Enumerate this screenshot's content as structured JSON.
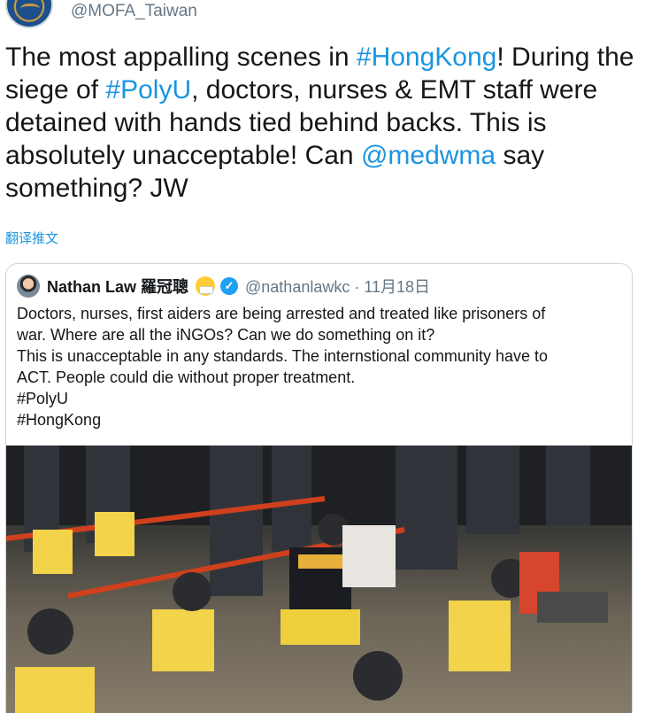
{
  "main_tweet": {
    "handle": "@MOFA_Taiwan",
    "text_1": "The most appalling scenes in ",
    "hashtag_1": "#HongKong",
    "text_2": "! During the siege of ",
    "hashtag_2": "#PolyU",
    "text_3": ", doctors, nurses & EMT staff were detained with hands tied behind backs. This is absolutely unacceptable! Can ",
    "mention": "@medwma",
    "text_4": " say something? JW",
    "translate_label": "翻译推文"
  },
  "quoted_tweet": {
    "name": "Nathan Law 羅冠聰",
    "handle_date": "@nathanlawkc · 11月18日",
    "lines": [
      "Doctors, nurses, first aiders are being arrested and treated like prisoners of",
      "war. Where are all the iNGOs? Can we do something on it?",
      "This is unacceptable in any standards. The internstional community have to",
      "ACT. People could die without proper treatment.",
      "#PolyU",
      "#HongKong"
    ],
    "verified_icon": "verified-badge-icon",
    "emoji_icon": "mask-face-emoji-icon"
  },
  "colors": {
    "link": "#1b95e0",
    "text": "#14171a",
    "muted": "#657786",
    "border": "#ccd6dd",
    "verified": "#1da1f2"
  }
}
